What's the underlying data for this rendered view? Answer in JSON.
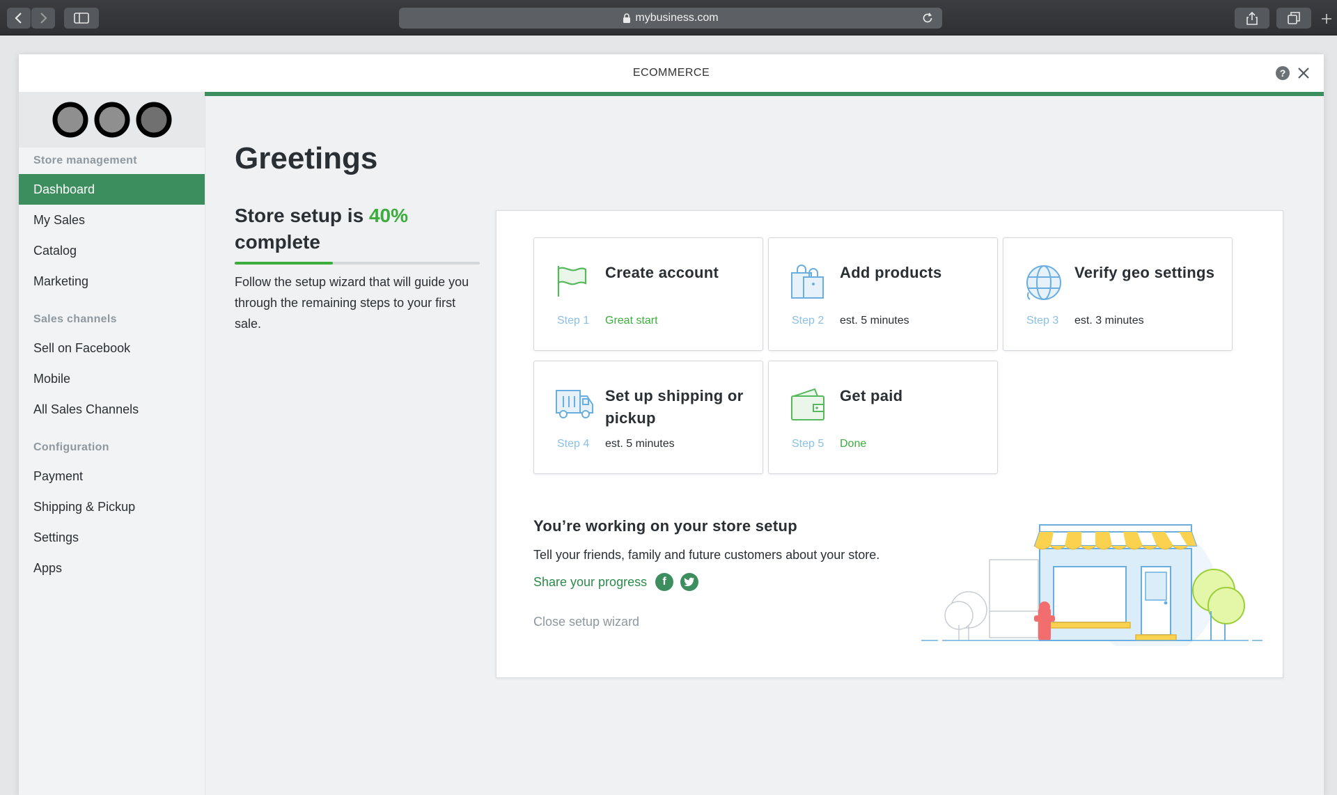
{
  "browser": {
    "url": "mybusiness.com"
  },
  "window": {
    "title": "ECOMMERCE"
  },
  "sidebar": {
    "sections": [
      {
        "label": "Store management",
        "items": [
          "Dashboard",
          "My Sales",
          "Catalog",
          "Marketing"
        ]
      },
      {
        "label": "Sales channels",
        "items": [
          "Sell on Facebook",
          "Mobile",
          "All Sales Channels"
        ]
      },
      {
        "label": "Configuration",
        "items": [
          "Payment",
          "Shipping & Pickup",
          "Settings",
          "Apps"
        ]
      }
    ],
    "active_item": "Dashboard"
  },
  "main": {
    "greeting": "Greetings",
    "setup_prefix": "Store setup is",
    "setup_percent": "40%",
    "setup_suffix": "complete",
    "progress": 0.4,
    "setup_description": "Follow the setup wizard that will guide you through the remaining steps to your first sale."
  },
  "steps": [
    {
      "title": "Create account",
      "step": "Step 1",
      "status": "Great start",
      "done": true,
      "icon": "flag-icon"
    },
    {
      "title": "Add products",
      "step": "Step 2",
      "status": "est. 5 minutes",
      "done": false,
      "icon": "shopping-bag-icon"
    },
    {
      "title": "Verify geo settings",
      "step": "Step 3",
      "status": "est. 3 minutes",
      "done": false,
      "icon": "globe-icon"
    },
    {
      "title": "Set up shipping or pickup",
      "step": "Step 4",
      "status": "est. 5 minutes",
      "done": false,
      "icon": "truck-icon"
    },
    {
      "title": "Get paid",
      "step": "Step 5",
      "status": "Done",
      "done": true,
      "icon": "wallet-icon"
    }
  ],
  "working": {
    "title": "You’re working on your store setup",
    "description": "Tell your friends, family and future customers about your store.",
    "share_label": "Share your progress",
    "facebook": "f",
    "close_label": "Close setup wizard"
  },
  "colors": {
    "brand_green": "#3d8e5f",
    "accent_green": "#3cad3c",
    "icon_blue": "#8ac0e6"
  }
}
